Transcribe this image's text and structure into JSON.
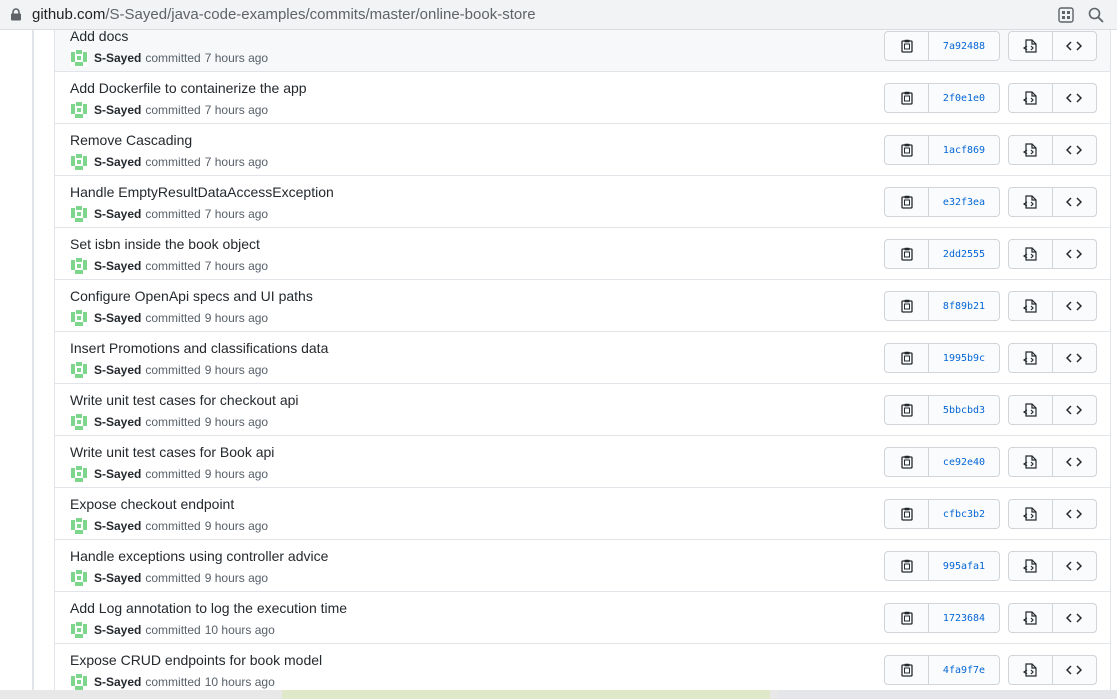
{
  "browser": {
    "url_host": "github.com",
    "url_path": "/S-Sayed/java-code-examples/commits/master/online-book-store"
  },
  "commits": [
    {
      "message": "Add docs",
      "author": "S-Sayed",
      "verb": "committed",
      "time": "7 hours ago",
      "sha": "7a92488"
    },
    {
      "message": "Add Dockerfile to containerize the app",
      "author": "S-Sayed",
      "verb": "committed",
      "time": "7 hours ago",
      "sha": "2f0e1e0"
    },
    {
      "message": "Remove Cascading",
      "author": "S-Sayed",
      "verb": "committed",
      "time": "7 hours ago",
      "sha": "1acf869"
    },
    {
      "message": "Handle EmptyResultDataAccessException",
      "author": "S-Sayed",
      "verb": "committed",
      "time": "7 hours ago",
      "sha": "e32f3ea"
    },
    {
      "message": "Set isbn inside the book object",
      "author": "S-Sayed",
      "verb": "committed",
      "time": "7 hours ago",
      "sha": "2dd2555"
    },
    {
      "message": "Configure OpenApi specs and UI paths",
      "author": "S-Sayed",
      "verb": "committed",
      "time": "9 hours ago",
      "sha": "8f89b21"
    },
    {
      "message": "Insert Promotions and classifications data",
      "author": "S-Sayed",
      "verb": "committed",
      "time": "9 hours ago",
      "sha": "1995b9c"
    },
    {
      "message": "Write unit test cases for checkout api",
      "author": "S-Sayed",
      "verb": "committed",
      "time": "9 hours ago",
      "sha": "5bbcbd3"
    },
    {
      "message": "Write unit test cases for Book api",
      "author": "S-Sayed",
      "verb": "committed",
      "time": "9 hours ago",
      "sha": "ce92e40"
    },
    {
      "message": "Expose checkout endpoint",
      "author": "S-Sayed",
      "verb": "committed",
      "time": "9 hours ago",
      "sha": "cfbc3b2"
    },
    {
      "message": "Handle exceptions using controller advice",
      "author": "S-Sayed",
      "verb": "committed",
      "time": "9 hours ago",
      "sha": "995afa1"
    },
    {
      "message": "Add Log annotation to log the execution time",
      "author": "S-Sayed",
      "verb": "committed",
      "time": "10 hours ago",
      "sha": "1723684"
    },
    {
      "message": "Expose CRUD endpoints for book model",
      "author": "S-Sayed",
      "verb": "committed",
      "time": "10 hours ago",
      "sha": "4fa9f7e"
    }
  ],
  "icons": {
    "lock": "lock-icon",
    "apps": "grid-icon",
    "zoom": "zoom-icon",
    "copy": "clipboard-icon",
    "browse": "file-code-icon",
    "code": "code-icon",
    "avatar": "identicon"
  },
  "colors": {
    "sha_link": "#0366d6",
    "avatar": "#7ed68c",
    "border": "#e1e4e8"
  }
}
